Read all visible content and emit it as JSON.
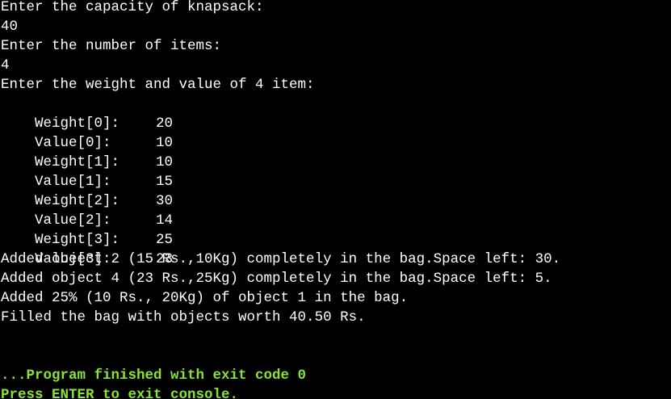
{
  "console": {
    "prompt_capacity": "Enter the capacity of knapsack:",
    "capacity_input": "40",
    "prompt_items": "Enter the number of items:",
    "items_input": "4",
    "prompt_weight_value": "Enter the weight and value of 4 item:",
    "entries": [
      {
        "label": "Weight[0]:",
        "value": "20"
      },
      {
        "label": "Value[0]:",
        "value": "10"
      },
      {
        "label": "Weight[1]:",
        "value": "10"
      },
      {
        "label": "Value[1]:",
        "value": "15"
      },
      {
        "label": "Weight[2]:",
        "value": "30"
      },
      {
        "label": "Value[2]:",
        "value": "14"
      },
      {
        "label": "Weight[3]:",
        "value": "25"
      },
      {
        "label": "Value[3]:",
        "value": "23"
      }
    ],
    "results": [
      "Added object 2 (15 Rs.,10Kg) completely in the bag.Space left: 30.",
      "Added object 4 (23 Rs.,25Kg) completely in the bag.Space left: 5.",
      "Added 25% (10 Rs., 20Kg) of object 1 in the bag.",
      "Filled the bag with objects worth 40.50 Rs."
    ],
    "exit_message": "...Program finished with exit code 0",
    "press_enter": "Press ENTER to exit console."
  },
  "colors": {
    "background": "#000000",
    "text": "#ffffff",
    "status_text": "#8ae234"
  }
}
